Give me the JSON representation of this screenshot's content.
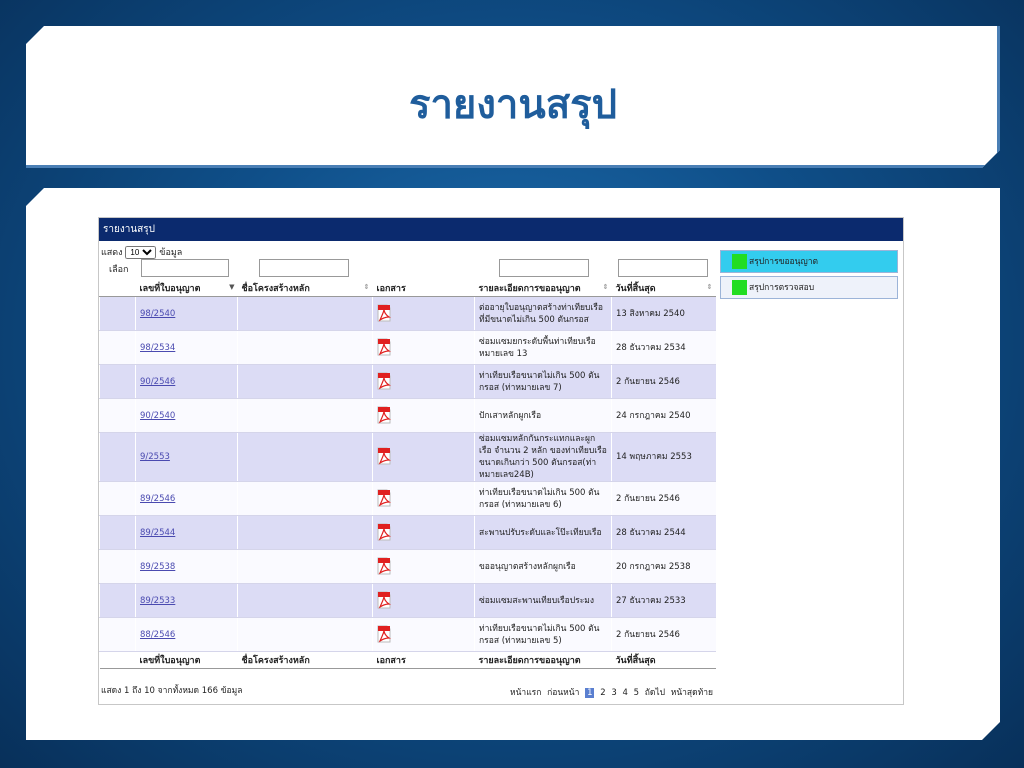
{
  "slide": {
    "title": "รายงานสรุป"
  },
  "report": {
    "header": "รายงานสรุป",
    "show_prefix": "แสดง",
    "page_size": "10",
    "show_suffix": "ข้อมูล",
    "filter_label": "เลือก",
    "columns": [
      "เลขที่ใบอนุญาต",
      "ชื่อโครงสร้างหลัก",
      "เอกสาร",
      "รายละเอียดการขออนุญาต",
      "วันที่สิ้นสุด"
    ],
    "rows": [
      {
        "license": "98/2540",
        "name": "",
        "detail": "ต่ออายุใบอนุญาตสร้างท่าเทียบเรือที่มีขนาดไม่เกิน 500 ตันกรอส",
        "end": "13 สิงหาคม 2540"
      },
      {
        "license": "98/2534",
        "name": "",
        "detail": "ซ่อมแซมยกระดับพื้นท่าเทียบเรือหมายเลข 13",
        "end": "28 ธันวาคม 2534"
      },
      {
        "license": "90/2546",
        "name": "",
        "detail": "ท่าเทียบเรือขนาดไม่เกิน 500 ตันกรอส (ท่าหมายเลข 7)",
        "end": "2 กันยายน 2546"
      },
      {
        "license": "90/2540",
        "name": "",
        "detail": "ปักเสาหลักผูกเรือ",
        "end": "24 กรกฎาคม 2540"
      },
      {
        "license": "9/2553",
        "name": "",
        "detail": "ซ่อมแซมหลักกันกระแทกและผูกเรือ จำนวน 2 หลัก ของท่าเทียบเรือขนาดเกินกว่า 500 ตันกรอส(ท่าหมายเลข24B)",
        "end": "14 พฤษภาคม 2553"
      },
      {
        "license": "89/2546",
        "name": "",
        "detail": "ท่าเทียบเรือขนาดไม่เกิน 500 ตันกรอส (ท่าหมายเลข 6)",
        "end": "2 กันยายน 2546"
      },
      {
        "license": "89/2544",
        "name": "",
        "detail": "สะพานปรับระดับและโป๊ะเทียบเรือ",
        "end": "28 ธันวาคม 2544"
      },
      {
        "license": "89/2538",
        "name": "",
        "detail": "ขออนุญาตสร้างหลักผูกเรือ",
        "end": "20 กรกฎาคม 2538"
      },
      {
        "license": "89/2533",
        "name": "",
        "detail": "ซ่อมแซมสะพานเทียบเรือประมง",
        "end": "27 ธันวาคม 2533"
      },
      {
        "license": "88/2546",
        "name": "",
        "detail": "ท่าเทียบเรือขนาดไม่เกิน 500 ตันกรอส (ท่าหมายเลข 5)",
        "end": "2 กันยายน 2546"
      }
    ],
    "info": "แสดง 1 ถึง 10 จากทั้งหมด 166 ข้อมูล",
    "pager": {
      "first": "หน้าแรก",
      "prev": "ก่อนหน้า",
      "pages": [
        "1",
        "2",
        "3",
        "4",
        "5"
      ],
      "next": "ถัดไป",
      "last": "หน้าสุดท้าย"
    }
  },
  "side_menu": [
    {
      "label": "สรุปการขออนุญาต"
    },
    {
      "label": "สรุปการตรวจสอบ"
    }
  ],
  "colors": {
    "title": "#1f5d9c",
    "header_bar": "#0b2a6e",
    "row_odd": "#dcdcf5",
    "side_active": "#33ccee",
    "side_marker": "#22dd22",
    "pdf_red": "#e02020"
  }
}
